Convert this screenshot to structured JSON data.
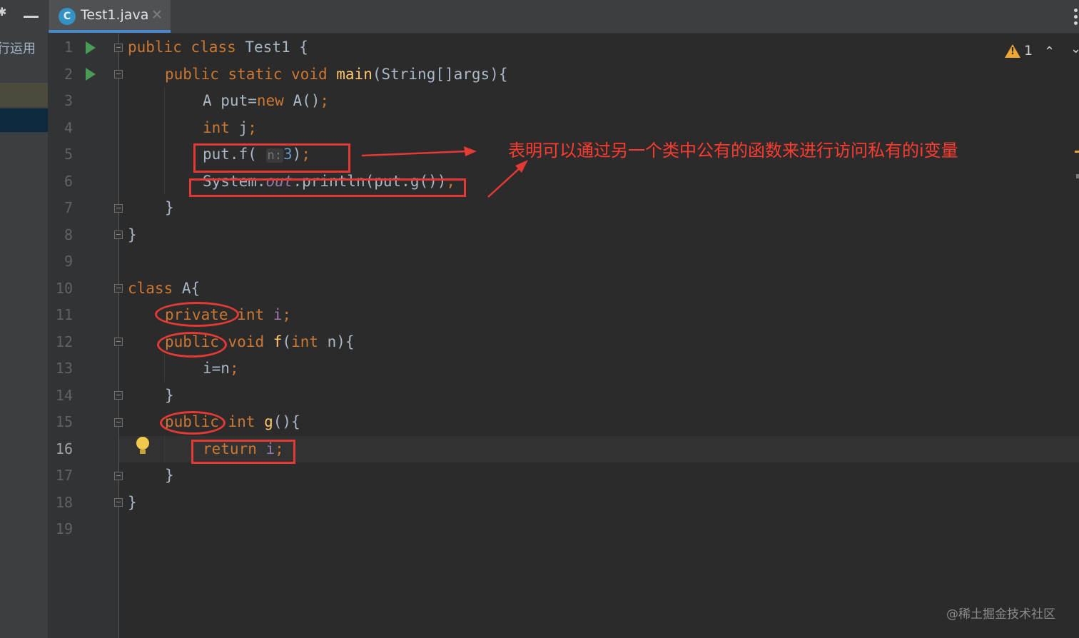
{
  "sidebar": {
    "project_label": "行运用"
  },
  "tab": {
    "file_name": "Test1.java",
    "icon_letter": "C"
  },
  "inspection": {
    "warning_count": "1"
  },
  "line_numbers": [
    "1",
    "2",
    "3",
    "4",
    "5",
    "6",
    "7",
    "8",
    "9",
    "10",
    "11",
    "12",
    "13",
    "14",
    "15",
    "16",
    "17",
    "18",
    "19"
  ],
  "code": {
    "l1": {
      "kw1": "public",
      "kw2": "class",
      "name": "Test1 {"
    },
    "l2": {
      "kw1": "public",
      "kw2": "static",
      "kw3": "void",
      "fn": "main",
      "rest": "(String[]args){"
    },
    "l3": {
      "a": "A put=",
      "kw": "new",
      "b": " A()",
      "semi": ";"
    },
    "l4": {
      "kw": "int",
      "b": " j",
      "semi": ";"
    },
    "l5": {
      "a": "put.f( ",
      "hint": "n:",
      "num": "3",
      "b": ")",
      "semi": ";"
    },
    "l6": {
      "a": "System.",
      "fld": "out",
      "b": ".println(put.g())",
      "semi": ";"
    },
    "l7": {
      "a": "}"
    },
    "l8": {
      "a": "}"
    },
    "l10": {
      "kw": "class",
      "b": " A{"
    },
    "l11": {
      "kw1": "private",
      "kw2": "int",
      "fld": "i",
      "semi": ";"
    },
    "l12": {
      "kw1": "public",
      "kw2": "void",
      "fn": "f",
      "a": "(",
      "kw3": "int",
      "b": " n){"
    },
    "l13": {
      "a": "i=n",
      "semi": ";"
    },
    "l14": {
      "a": "}"
    },
    "l15": {
      "kw1": "public",
      "kw2": "int",
      "fn": "g",
      "a": "(){"
    },
    "l16": {
      "kw": "return",
      "fld": "i",
      "semi": ";"
    },
    "l17": {
      "a": "}"
    },
    "l18": {
      "a": "}"
    }
  },
  "annotation": {
    "text": "表明可以通过另一个类中公有的函数来进行访问私有的i变量"
  },
  "watermark": "@稀土掘金技术社区"
}
